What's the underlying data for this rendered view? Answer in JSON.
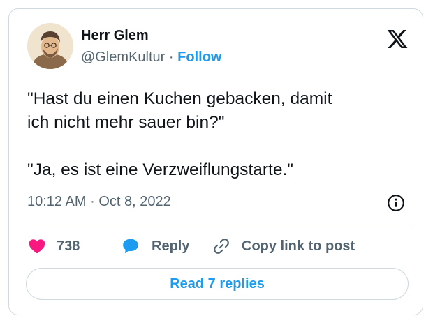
{
  "author": {
    "name": "Herr Glem",
    "handle": "@GlemKultur",
    "separator": "·",
    "follow_label": "Follow"
  },
  "tweet": {
    "lines": [
      "\"Hast du einen Kuchen gebacken, damit",
      "ich nicht mehr sauer bin?\"",
      "\"Ja, es ist eine Verzweiflungstarte.\""
    ],
    "time": "10:12 AM",
    "date_separator": "·",
    "date": "Oct 8, 2022"
  },
  "actions": {
    "like_count": "738",
    "reply_label": "Reply",
    "copy_label": "Copy link to post",
    "read_replies_label": "Read 7 replies"
  },
  "icons": {
    "logo": "x-logo-icon",
    "info": "info-icon",
    "like": "heart-icon",
    "reply": "speech-bubble-icon",
    "copy": "link-icon"
  },
  "colors": {
    "accent": "#1d9bf0",
    "like": "#f91880",
    "text": "#0f1419",
    "muted": "#536471",
    "border": "#cfd9de"
  }
}
